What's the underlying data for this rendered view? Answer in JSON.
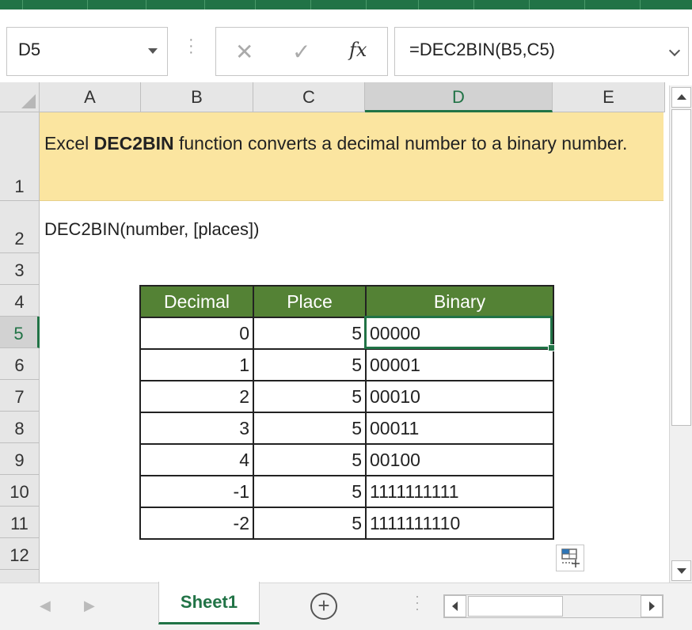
{
  "formula_bar": {
    "name_box": "D5",
    "cancel_icon": "x-icon",
    "enter_icon": "check-icon",
    "fx_label": "fx",
    "formula": "=DEC2BIN(B5,C5)"
  },
  "columns": [
    "A",
    "B",
    "C",
    "D",
    "E"
  ],
  "selected_column": "D",
  "rows": [
    "1",
    "2",
    "3",
    "4",
    "5",
    "6",
    "7",
    "8",
    "9",
    "10",
    "11",
    "12"
  ],
  "selected_row": "5",
  "sheet": {
    "title_prefix": "Excel ",
    "title_bold": "DEC2BIN",
    "title_rest": " function converts a decimal number to a binary number.",
    "syntax": "DEC2BIN(number, [places])"
  },
  "table": {
    "headers": [
      "Decimal",
      "Place",
      "Binary"
    ],
    "rows": [
      [
        "0",
        "5",
        "00000"
      ],
      [
        "1",
        "5",
        "00001"
      ],
      [
        "2",
        "5",
        "00010"
      ],
      [
        "3",
        "5",
        "00011"
      ],
      [
        "4",
        "5",
        "00100"
      ],
      [
        "-1",
        "5",
        "1111111111"
      ],
      [
        "-2",
        "5",
        "1111111110"
      ]
    ]
  },
  "tabs": {
    "active": "Sheet1",
    "add_icon": "plus-circle-icon"
  },
  "colors": {
    "accent": "#217346",
    "header_fill": "#548235",
    "highlight_fill": "#fbe5a0"
  }
}
